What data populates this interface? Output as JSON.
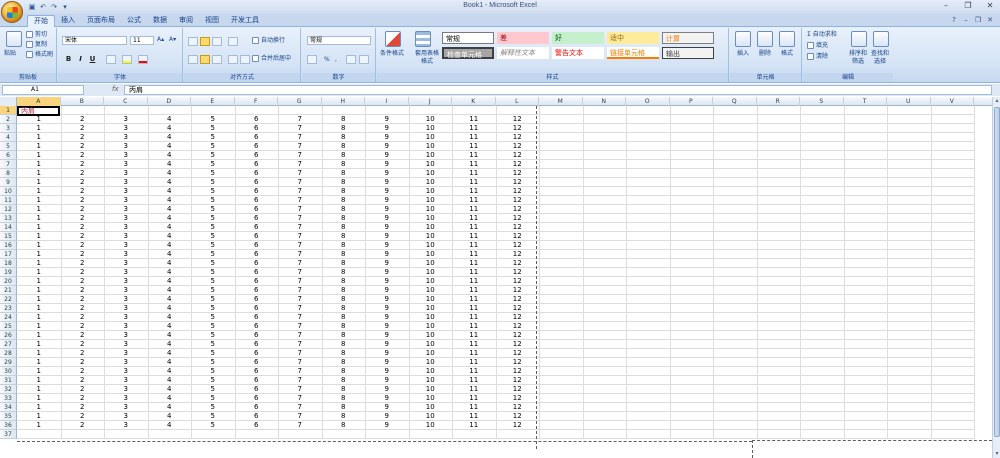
{
  "window": {
    "title": "Book1 - Microsoft Excel"
  },
  "qat": {
    "save": "save-icon",
    "undo": "undo-icon",
    "redo": "redo-icon",
    "more": "▾"
  },
  "tabs": [
    "开始",
    "插入",
    "页面布局",
    "公式",
    "数据",
    "审阅",
    "视图",
    "开发工具"
  ],
  "active_tab": "开始",
  "ribbon": {
    "clipboard": {
      "paste": "粘贴",
      "cut": "剪切",
      "copy": "复制",
      "format_painter": "格式刷",
      "label": "剪贴板"
    },
    "font": {
      "name": "宋体",
      "size": "11",
      "bold": "B",
      "italic": "I",
      "underline": "U",
      "label": "字体",
      "grow": "A▴",
      "shrink": "A▾"
    },
    "alignment": {
      "wrap": "自动换行",
      "merge": "合并后居中",
      "label": "对齐方式"
    },
    "number": {
      "format": "常规",
      "percent": "%",
      "comma": ",",
      "label": "数字"
    },
    "styles": {
      "cond_format": "条件格式",
      "table_format": "套用表格格式",
      "label": "样式",
      "cells": [
        {
          "text": "常规",
          "bg": "#ffffff",
          "fg": "#000000"
        },
        {
          "text": "差",
          "bg": "#ffc7ce",
          "fg": "#9c0006"
        },
        {
          "text": "好",
          "bg": "#c6efce",
          "fg": "#006100"
        },
        {
          "text": "适中",
          "bg": "#ffeb9c",
          "fg": "#9c6500"
        },
        {
          "text": "计算",
          "bg": "#f2f2f2",
          "fg": "#fa7d00"
        },
        {
          "text": "检查单元格",
          "bg": "#a5a5a5",
          "fg": "#ffffff"
        },
        {
          "text": "解释性文本",
          "bg": "#ffffff",
          "fg": "#7f7f7f"
        },
        {
          "text": "警告文本",
          "bg": "#ffffff",
          "fg": "#ff0000"
        },
        {
          "text": "链接单元格",
          "bg": "#ffffff",
          "fg": "#fa7d00"
        },
        {
          "text": "输出",
          "bg": "#f2f2f2",
          "fg": "#3f3f3f"
        }
      ]
    },
    "cells_group": {
      "insert": "插入",
      "delete": "删除",
      "format": "格式",
      "label": "单元格"
    },
    "editing": {
      "autosum": "Σ 自动求和",
      "fill": "填充",
      "clear": "清除",
      "sort": "排序和筛选",
      "find": "查找和选择",
      "label": "编辑"
    }
  },
  "formula_bar": {
    "name_box": "A1",
    "fx": "fx",
    "value": "丙肩"
  },
  "sheet": {
    "columns": [
      "A",
      "B",
      "C",
      "D",
      "E",
      "F",
      "G",
      "H",
      "I",
      "J",
      "K",
      "L",
      "M",
      "N",
      "O",
      "P",
      "Q",
      "R",
      "S",
      "T",
      "U",
      "V"
    ],
    "selected_column": "A",
    "selected_row": 1,
    "row_count": 37,
    "first_row": [
      "丙肩"
    ],
    "data_rows_from": 2,
    "data_rows_to": 36,
    "data_values": [
      1,
      2,
      3,
      4,
      5,
      6,
      7,
      8,
      9,
      10,
      11,
      12
    ]
  }
}
